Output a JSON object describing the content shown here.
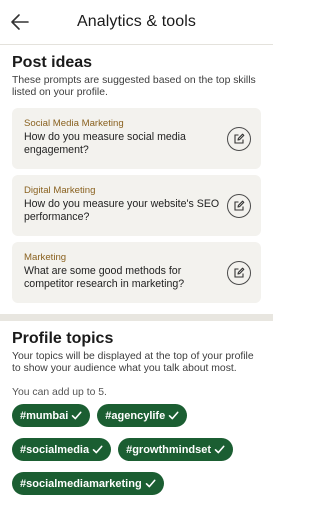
{
  "header": {
    "title": "Analytics & tools"
  },
  "post_ideas": {
    "title": "Post ideas",
    "description": "These prompts are suggested based on the top skills listed on your profile.",
    "cards": [
      {
        "category": "Social Media Marketing",
        "question": "How do you measure social media engagement?"
      },
      {
        "category": "Digital Marketing",
        "question": "How do you measure your website's SEO performance?"
      },
      {
        "category": "Marketing",
        "question": "What are some good methods for competitor research in marketing?"
      }
    ]
  },
  "profile_topics": {
    "title": "Profile topics",
    "description": "Your topics will be displayed at the top of your profile to show your audience what you talk about most.",
    "limit_note": "You can add up to 5.",
    "chips": [
      {
        "label": "#mumbai"
      },
      {
        "label": "#agencylife"
      },
      {
        "label": "#socialmedia"
      },
      {
        "label": "#growthmindset"
      },
      {
        "label": "#socialmediamarketing"
      }
    ]
  },
  "colors": {
    "chip_bg": "#1b5e32",
    "category_text": "#8a6220",
    "card_bg": "#f3f2ee",
    "divider": "#e8e6e0"
  },
  "icons": {
    "back": "arrow-left-icon",
    "edit": "pencil-edit-icon",
    "chip_check": "check-icon"
  }
}
